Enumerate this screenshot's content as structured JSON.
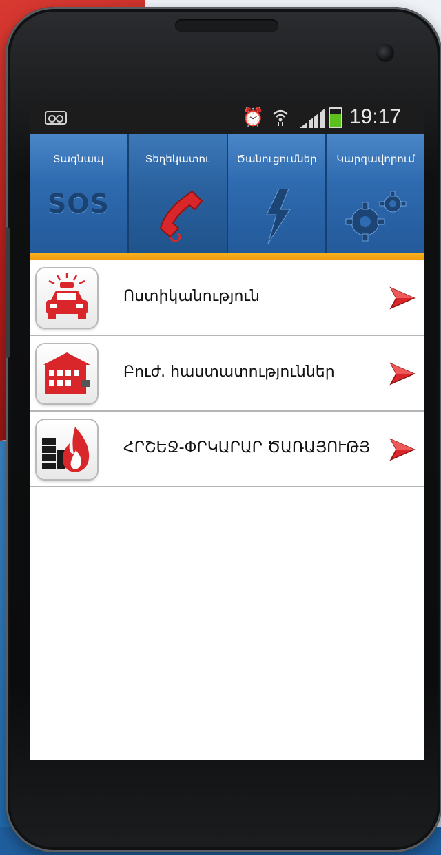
{
  "status_bar": {
    "time": "19:17",
    "icons": [
      "voicemail-icon",
      "alarm-icon",
      "wifi-icon",
      "signal-icon",
      "battery-icon"
    ],
    "battery_level": 0.75
  },
  "tabs": [
    {
      "label": "Տագնապ",
      "icon": "sos-icon",
      "icon_text": "SOS",
      "active": false
    },
    {
      "label": "Տեղեկատու",
      "icon": "phone-handset-icon",
      "active": true
    },
    {
      "label": "Ծանուցումներ",
      "icon": "lightning-icon",
      "active": false
    },
    {
      "label": "Կարգավորում",
      "icon": "gears-icon",
      "active": false
    }
  ],
  "list": [
    {
      "label": "Ոստիկանություն",
      "icon": "police-car-icon"
    },
    {
      "label": "Բուժ. հաստատություններ",
      "icon": "hospital-icon"
    },
    {
      "label": "ՀՐՇԵՋ-ՓՐԿԱՐԱՐ ԾԱՌԱՅՈՒԹՅ",
      "icon": "fire-icon"
    }
  ],
  "colors": {
    "tab_blue": "#2f6bb0",
    "accent_orange": "#f09a10",
    "icon_red": "#d8262a"
  }
}
